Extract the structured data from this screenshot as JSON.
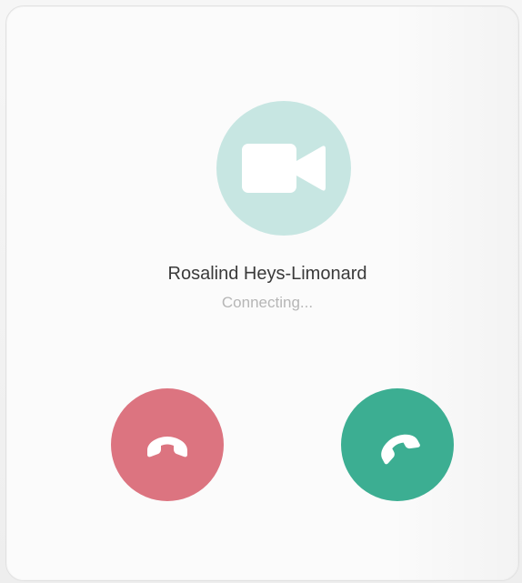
{
  "caller": {
    "name": "Rosalind Heys-Limonard",
    "status": "Connecting..."
  },
  "icons": {
    "video": "video-camera-icon",
    "decline": "phone-hangup-icon",
    "accept": "phone-answer-icon"
  },
  "colors": {
    "video_circle": "#c7e6e2",
    "decline_button": "#dc7480",
    "accept_button": "#3cae92",
    "name_text": "#3a3a3a",
    "status_text": "#b6b6b6"
  }
}
